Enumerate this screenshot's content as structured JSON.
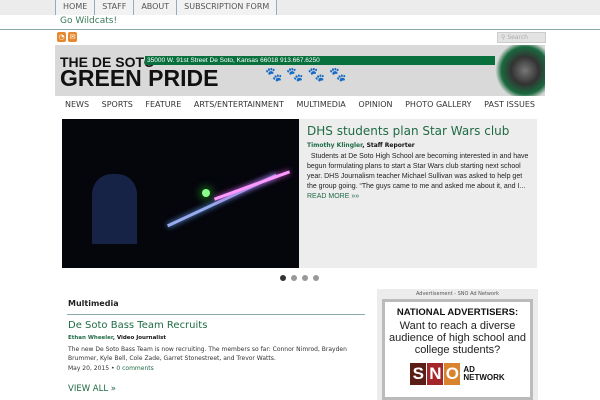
{
  "top_menu": [
    "HOME",
    "STAFF",
    "ABOUT",
    "SUBSCRIPTION FORM"
  ],
  "tagline": "Go Wildcats!",
  "search": {
    "placeholder": "Search"
  },
  "banner": {
    "line1": "THE DE SOTO",
    "line2": "GREEN PRIDE",
    "address": "35000 W. 91st Street  De Soto, Kansas 66018  913.667.6250"
  },
  "nav": [
    "NEWS",
    "SPORTS",
    "FEATURE",
    "ARTS/ENTERTAINMENT",
    "MULTIMEDIA",
    "OPINION",
    "PHOTO GALLERY",
    "PAST ISSUES"
  ],
  "featured": {
    "title": "DHS students plan Star Wars club",
    "author": "Timothy Klingler",
    "role": ", Staff Reporter",
    "body": "Students at De Soto High School are becoming interested in and have begun formulating plans to start a Star Wars club starting next school year. DHS Journalism teacher Michael Sullivan was asked to help get the group going. “The guys came to me and asked me about it, and I...",
    "read_more": "READ MORE »»"
  },
  "multimedia": {
    "heading": "Multimedia",
    "title": "De Soto Bass Team Recruits",
    "author": "Ethan Wheeler",
    "role": ", Video Journalist",
    "body": "The new De Soto Bass Team is now recruiting. The members so far: Connor Nimrod, Brayden Brummer, Kyle Bell, Cole Zade, Garret Stonestreet, and Trevor Watts.",
    "date": "May 20, 2015 • ",
    "comments": "0 comments",
    "view_all": "VIEW ALL »"
  },
  "ad": {
    "label": "Advertisement - SNO Ad Network",
    "heading": "NATIONAL ADVERTISERS:",
    "text": "Want to reach a diverse audience of high school and college students?",
    "logo": "SNO AD NETWORK",
    "logo_s": "S",
    "logo_n": "N",
    "logo_o": "O",
    "logo_ad": "AD",
    "logo_network": "NETWORK"
  }
}
